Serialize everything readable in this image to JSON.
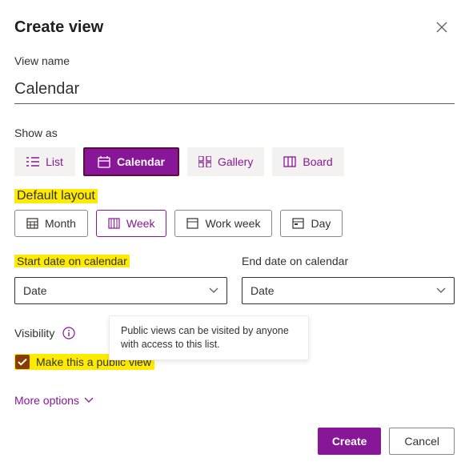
{
  "header": {
    "title": "Create view"
  },
  "view_name": {
    "label": "View name",
    "value": "Calendar"
  },
  "show_as": {
    "label": "Show as",
    "options": [
      {
        "key": "list",
        "label": "List"
      },
      {
        "key": "calendar",
        "label": "Calendar",
        "selected": true
      },
      {
        "key": "gallery",
        "label": "Gallery"
      },
      {
        "key": "board",
        "label": "Board"
      }
    ]
  },
  "default_layout": {
    "label": "Default layout",
    "options": [
      {
        "key": "month",
        "label": "Month"
      },
      {
        "key": "week",
        "label": "Week",
        "selected": true
      },
      {
        "key": "workweek",
        "label": "Work week"
      },
      {
        "key": "day",
        "label": "Day"
      }
    ]
  },
  "dates": {
    "start": {
      "label": "Start date on calendar",
      "value": "Date"
    },
    "end": {
      "label": "End date on calendar",
      "value": "Date"
    }
  },
  "visibility": {
    "label": "Visibility",
    "tooltip": "Public views can be visited by anyone with access to this list.",
    "checkbox_label": "Make this a public view",
    "checked": true
  },
  "more_options": {
    "label": "More options"
  },
  "footer": {
    "create": "Create",
    "cancel": "Cancel"
  }
}
